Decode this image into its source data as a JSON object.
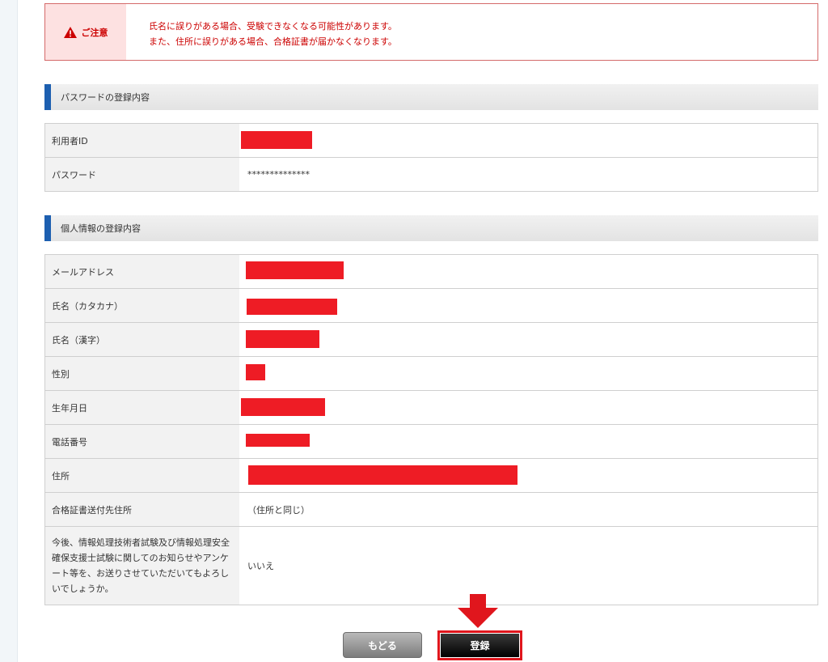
{
  "notice": {
    "label": "ご注意",
    "line1": "氏名に誤りがある場合、受験できなくなる可能性があります。",
    "line2": "また、住所に誤りがある場合、合格証書が届かなくなります。"
  },
  "password_section": {
    "title": "パスワードの登録内容",
    "rows": [
      {
        "label": "利用者ID",
        "value": ""
      },
      {
        "label": "パスワード",
        "value": "**************"
      }
    ]
  },
  "personal_section": {
    "title": "個人情報の登録内容",
    "rows": [
      {
        "label": "メールアドレス",
        "value": ""
      },
      {
        "label": "氏名（カタカナ）",
        "value": ""
      },
      {
        "label": "氏名（漢字）",
        "value": ""
      },
      {
        "label": "性別",
        "value": ""
      },
      {
        "label": "生年月日",
        "value": ""
      },
      {
        "label": "電話番号",
        "value": ""
      },
      {
        "label": "住所",
        "value": ""
      },
      {
        "label": "合格証書送付先住所",
        "value": "（住所と同じ）"
      },
      {
        "label": "今後、情報処理技術者試験及び情報処理安全確保支援士試験に関してのお知らせやアンケート等を、お送りさせていただいてもよろしいでしょうか。",
        "value": "いいえ"
      }
    ]
  },
  "buttons": {
    "back_label": "もどる",
    "register_label": "登録"
  },
  "colors": {
    "accent_blue": "#1d5fb0",
    "warning_red": "#cc0000",
    "highlight_red": "#e0161d"
  }
}
